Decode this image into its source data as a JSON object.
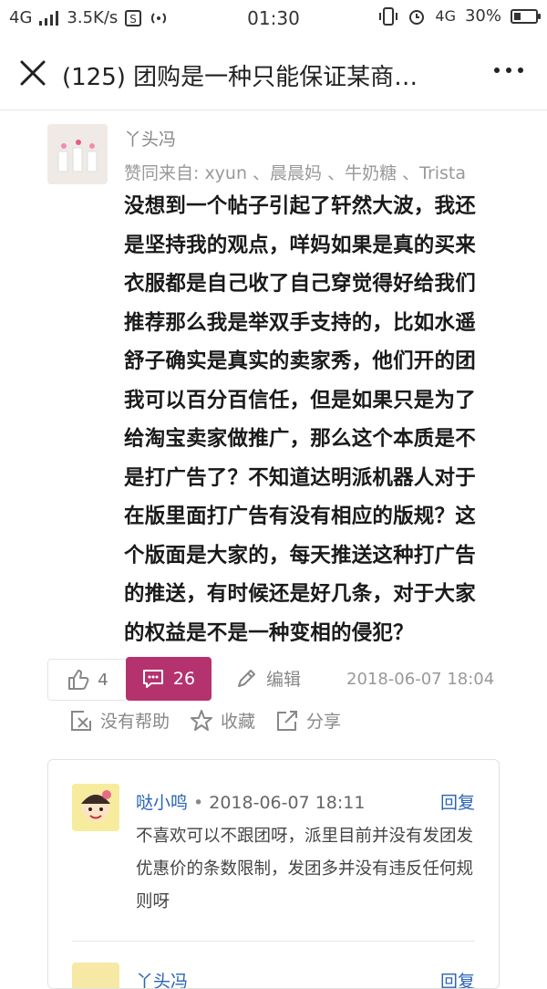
{
  "statusbar": {
    "network": "4G",
    "speed": "3.5K/s",
    "time": "01:30",
    "network_right": "4G",
    "battery": "30%",
    "battery_level": 0.3
  },
  "nav": {
    "title": "(125) 团购是一种只能保证某商…"
  },
  "post": {
    "author": "丫头冯",
    "upvoters": "赞同来自: xyun 、晨晨妈 、牛奶糖 、Trista",
    "content": "没想到一个帖子引起了轩然大波，我还是坚持我的观点，咩妈如果是真的买来衣服都是自己收了自己穿觉得好给我们推荐那么我是举双手支持的，比如水遥舒子确实是真实的卖家秀，他们开的团我可以百分百信任，但是如果只是为了给淘宝卖家做推广，那么这个本质是不是打广告了？不知道达明派机器人对于在版里面打广告有没有相应的版规？这个版面是大家的，每天推送这种打广告的推送，有时候还是好几条，对于大家的权益是不是一种变相的侵犯？",
    "like_count": "4",
    "comment_count": "26",
    "edit_label": "编辑",
    "timestamp": "2018-06-07 18:04",
    "unhelpful_label": "没有帮助",
    "favorite_label": "收藏",
    "share_label": "分享"
  },
  "comments": [
    {
      "author": "哒小鸣",
      "dot": "•",
      "time": "2018-06-07 18:11",
      "reply_label": "回复",
      "content": "不喜欢可以不跟团呀，派里目前并没有发团发优惠价的条数限制，发团多并没有违反任何规则呀"
    },
    {
      "author": "丫头冯",
      "reply_label": "回复"
    }
  ],
  "colors": {
    "accent": "#b4336f",
    "link": "#2b64b5"
  }
}
